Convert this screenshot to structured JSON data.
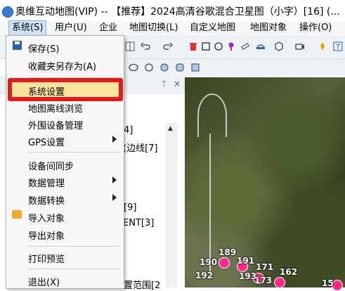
{
  "window": {
    "title": "奥维互动地图(VIP) -- 【推荐】2024高清谷歌混合卫星图（小字）[16] (..."
  },
  "menubar": {
    "items": [
      "系统(S)",
      "用户(U)",
      "企业",
      "地图切换(L)",
      "自定义地图",
      "地图对象",
      "操作(O)"
    ]
  },
  "system_menu": {
    "items": [
      {
        "label": "保存(S)",
        "icon": "save-icon",
        "submenu": false
      },
      {
        "label": "收藏夹另存为(A)",
        "submenu": false
      },
      {
        "label": "系统设置",
        "submenu": false,
        "highlighted": true
      },
      {
        "label": "地图离线浏览",
        "submenu": false
      },
      {
        "label": "外围设备管理",
        "submenu": false
      },
      {
        "label": "GPS设置",
        "submenu": true
      },
      {
        "label": "设备间同步",
        "submenu": false
      },
      {
        "label": "数据管理",
        "submenu": true
      },
      {
        "label": "数据转换",
        "submenu": true
      },
      {
        "label": "导入对象",
        "icon": "import-icon",
        "submenu": false
      },
      {
        "label": "导出对象",
        "submenu": false
      },
      {
        "label": "打印预览",
        "submenu": false
      },
      {
        "label": "退出(X)",
        "submenu": false
      }
    ]
  },
  "left_panel": {
    "tree_fragments": [
      "4]",
      "(边线[7]",
      "[9]",
      "ENT[3]",
      "置范围[2"
    ]
  },
  "map": {
    "labels": [
      "189",
      "190",
      "191",
      "171",
      "162",
      "192",
      "193",
      "173",
      "15"
    ]
  },
  "colors": {
    "highlight_box": "#e21b1b",
    "menu_active": "#cfe3f7",
    "selected_item": "#fce4a0"
  }
}
